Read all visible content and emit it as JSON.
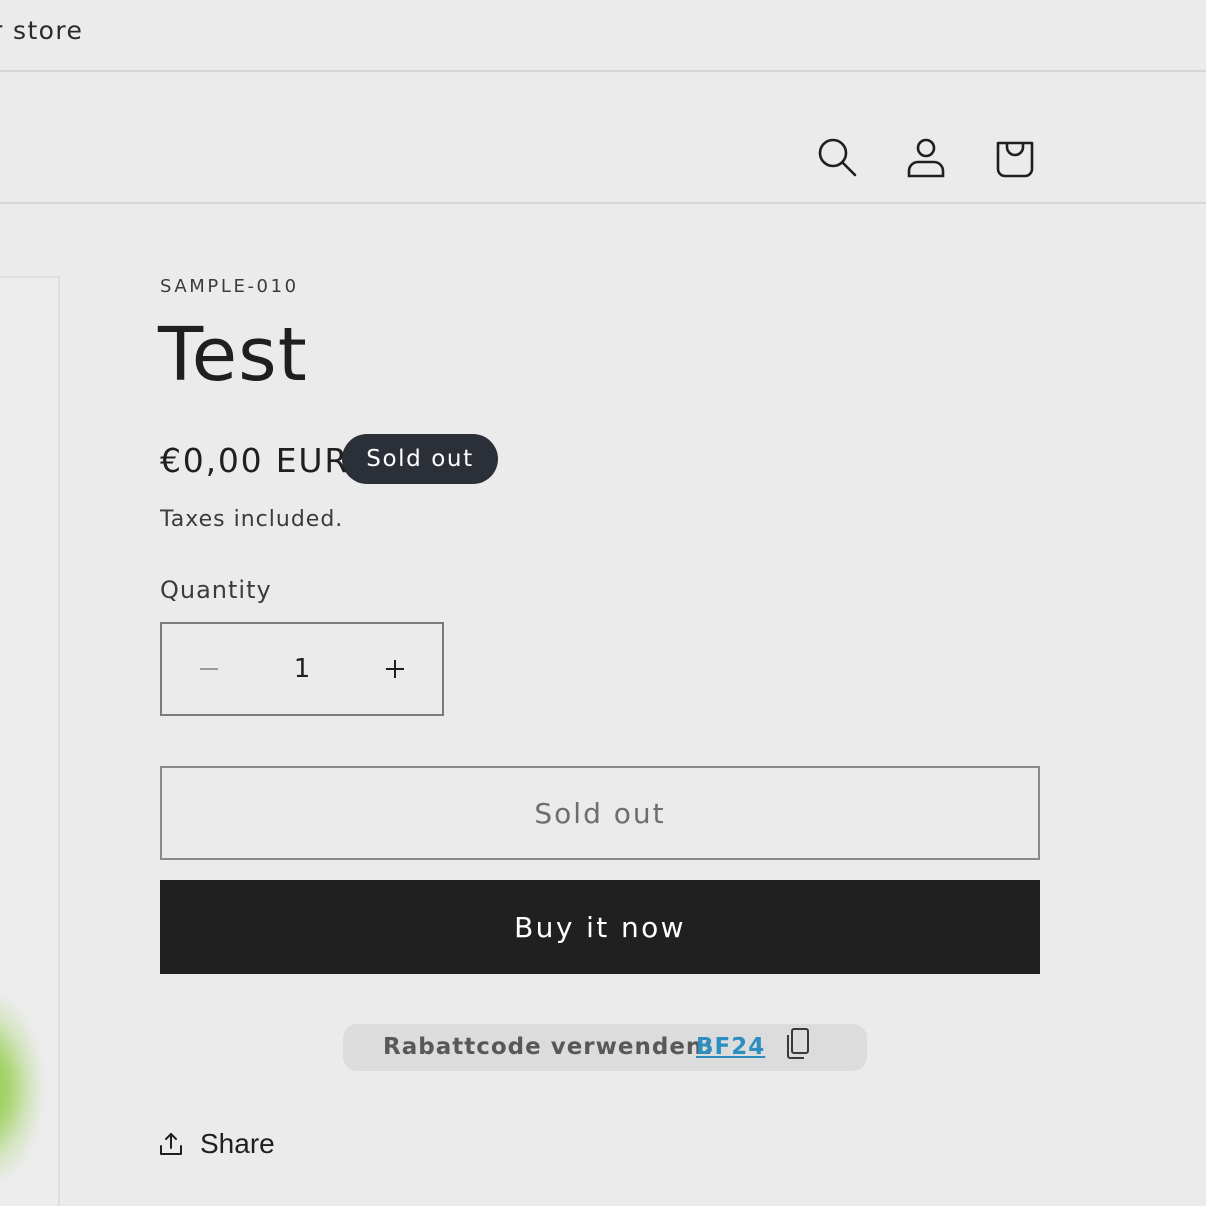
{
  "announcement": {
    "store_name": "r store"
  },
  "header": {
    "icons": [
      "search-icon",
      "account-icon",
      "cart-icon"
    ]
  },
  "product": {
    "vendor": "SAMPLE-010",
    "title": "Test",
    "price": "€0,00 EUR",
    "badge": "Sold out",
    "tax_note": "Taxes included.",
    "quantity_label": "Quantity",
    "quantity_value": "1",
    "sold_out_button": "Sold out",
    "buy_now_button": "Buy it now"
  },
  "discount": {
    "label": "Rabattcode verwenden:",
    "code": "BF24",
    "icon": "copy-icon"
  },
  "share": {
    "label": "Share",
    "icon": "share-icon"
  },
  "colors": {
    "background": "#ebebeb",
    "badge": "#2b2f37",
    "buy_button": "#202020",
    "discount_code": "#2c8fbf",
    "discount_bg": "#dcdcdc"
  }
}
